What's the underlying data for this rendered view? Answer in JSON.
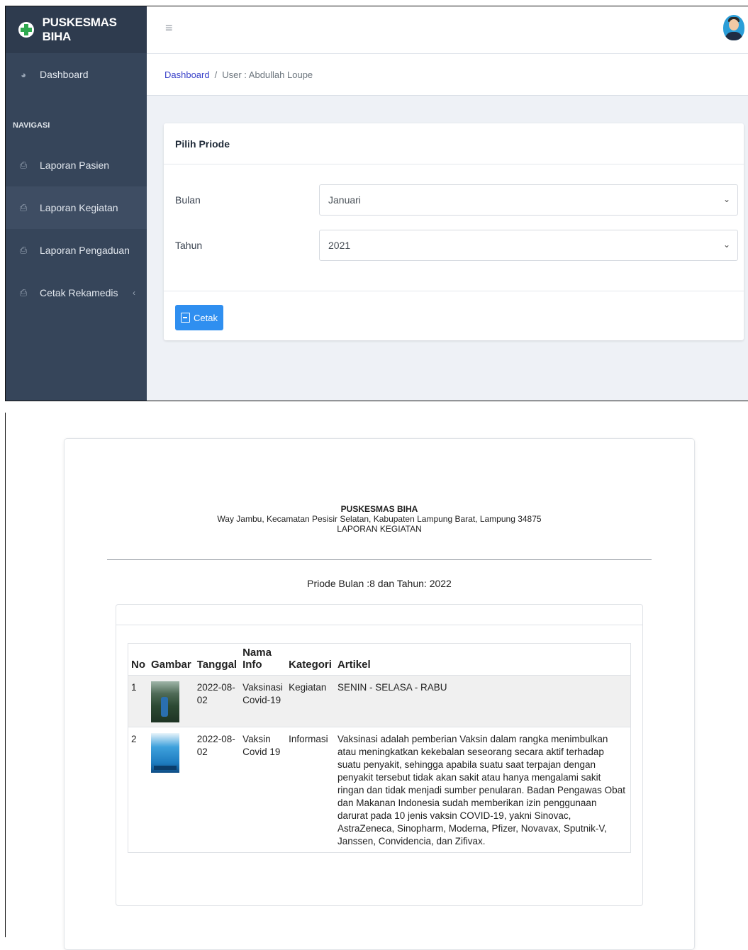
{
  "app": {
    "brand": "PUSKESMAS BIHA",
    "sidebar": {
      "dashboard": "Dashboard",
      "section": "NAVIGASI",
      "items": [
        {
          "label": "Laporan Pasien",
          "icon": "printer-icon"
        },
        {
          "label": "Laporan Kegiatan",
          "icon": "printer-icon",
          "active": true
        },
        {
          "label": "Laporan Pengaduan",
          "icon": "printer-icon"
        },
        {
          "label": "Cetak Rekamedis",
          "icon": "printer-icon"
        }
      ]
    },
    "breadcrumb": {
      "home": "Dashboard",
      "separator": "/",
      "current": "User : Abdullah Loupe"
    },
    "card": {
      "title": "Pilih Priode",
      "bulan_label": "Bulan",
      "bulan_value": "Januari",
      "tahun_label": "Tahun",
      "tahun_value": "2021",
      "button": "Cetak"
    },
    "colors": {
      "sidebar": "#36455a",
      "brand_bar": "#2e3b4e",
      "button": "#2f8ff0",
      "link": "#3b43c9"
    }
  },
  "report": {
    "title": "PUSKESMAS BIHA",
    "address": "Way Jambu, Kecamatan Pesisir Selatan, Kabupaten Lampung Barat, Lampung 34875",
    "subtitle": "LAPORAN KEGIATAN",
    "periode": "Priode Bulan :8 dan Tahun: 2022",
    "columns": [
      "No",
      "Gambar",
      "Tanggal",
      "Nama Info",
      "Kategori",
      "Artikel"
    ],
    "rows": [
      {
        "no": "1",
        "tanggal": "2022-08-02",
        "nama": "Vaksinasi Covid-19",
        "kategori": "Kegiatan",
        "artikel": "SENIN - SELASA - RABU"
      },
      {
        "no": "2",
        "tanggal": "2022-08-02",
        "nama": "Vaksin Covid 19",
        "kategori": "Informasi",
        "artikel": "Vaksinasi adalah pemberian Vaksin dalam rangka menimbulkan atau meningkatkan kekebalan seseorang secara aktif terhadap suatu penyakit, sehingga apabila suatu saat terpajan dengan penyakit tersebut tidak akan sakit atau hanya mengalami sakit ringan dan tidak menjadi sumber penularan. Badan Pengawas Obat dan Makanan Indonesia sudah memberikan izin penggunaan darurat pada 10 jenis vaksin COVID-19, yakni Sinovac, AstraZeneca, Sinopharm, Moderna, Pfizer, Novavax, Sputnik-V, Janssen, Convidencia, dan Zifivax."
      }
    ]
  }
}
